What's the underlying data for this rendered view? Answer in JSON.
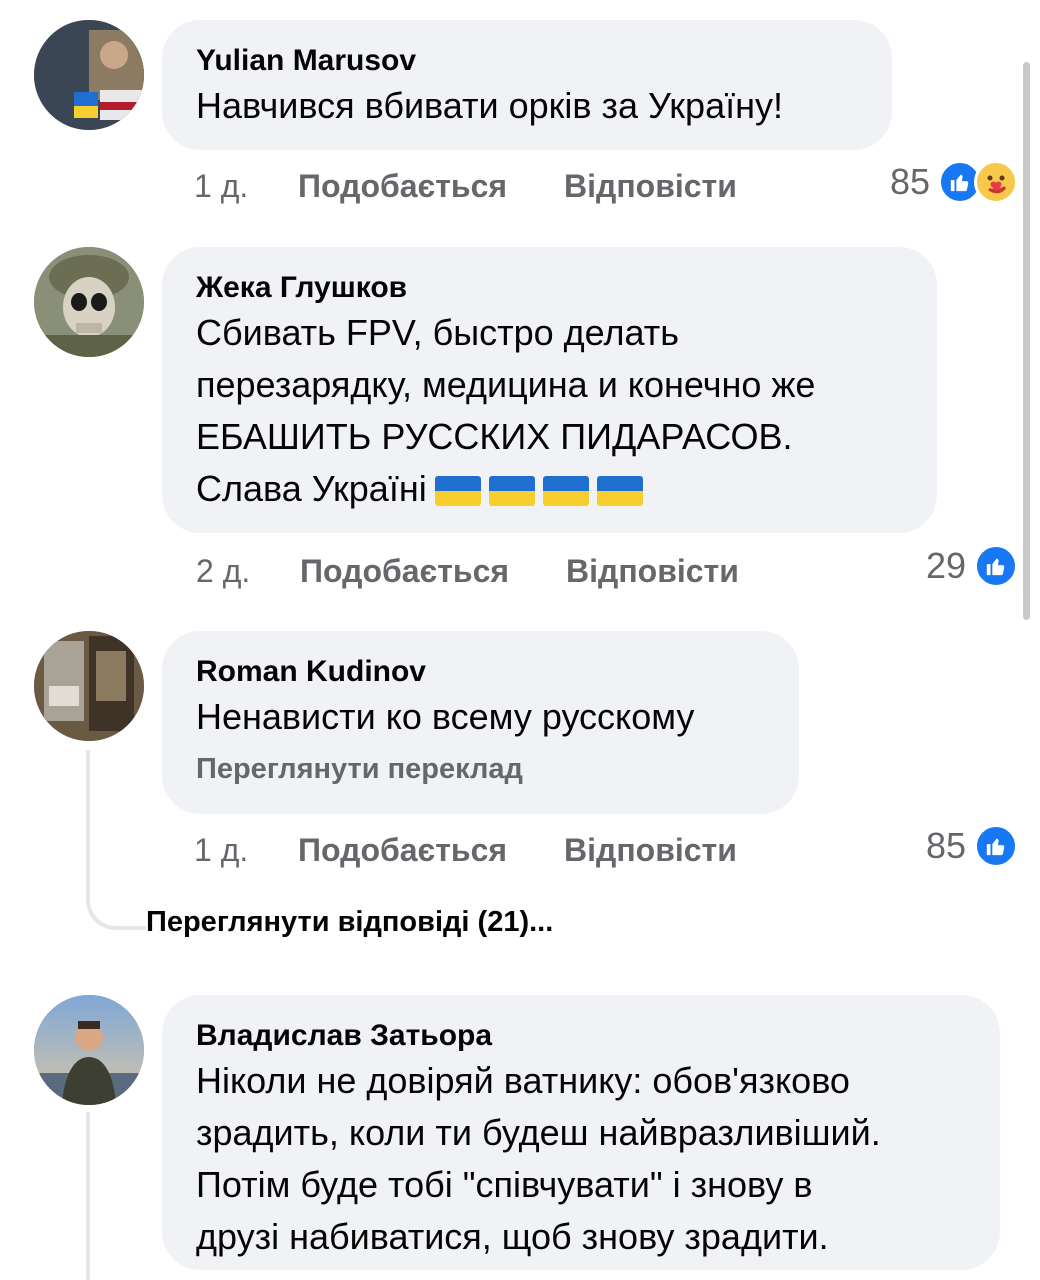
{
  "comments": [
    {
      "author": "Yulian  Marusov",
      "text": "Навчився вбивати орків за Україну!",
      "time": "1 д.",
      "like": "Подобається",
      "reply": "Відповісти",
      "count": "85",
      "reactions": [
        "like-icon",
        "care-icon"
      ]
    },
    {
      "author": "Жека Глушков",
      "text": "Сбивать FPV, быстро делать\nперезарядку, медицина и конечно же\nЕБАШИТЬ РУССКИХ ПИДАРАСОВ.\nСлава Україні",
      "time": "2 д.",
      "like": "Подобається",
      "reply": "Відповісти",
      "count": "29",
      "reactions": [
        "like-icon"
      ]
    },
    {
      "author": "Roman Kudinov",
      "text": "Ненависти ко всему русскому",
      "translate": "Переглянути переклад",
      "time": "1 д.",
      "like": "Подобається",
      "reply": "Відповісти",
      "count": "85",
      "reactions": [
        "like-icon"
      ],
      "view_replies": "Переглянути відповіді (21)..."
    },
    {
      "author": "Владислав Затьора",
      "text": "Ніколи не довіряй ватнику: обов'язково\nзрадить, коли ти будеш найвразливіший.\nПотім буде тобі \"співчувати\" і знову в\nдрузі набиватися, щоб знову зрадити."
    }
  ],
  "colors": {
    "bubble": "#f0f2f5",
    "meta_text": "#65676b",
    "like_blue": "#1877f2"
  }
}
